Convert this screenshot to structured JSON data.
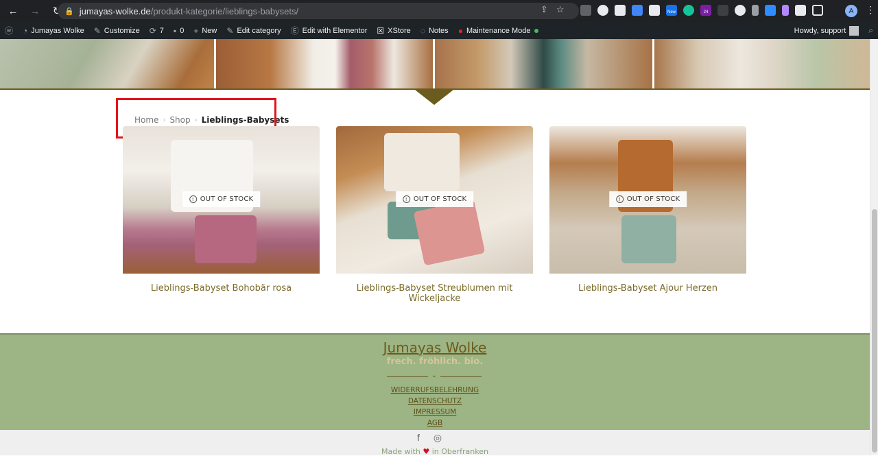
{
  "browser": {
    "url_domain": "jumayas-wolke.de",
    "url_path": "/produkt-kategorie/lieblings-babysets/",
    "profile_initial": "A",
    "ext_badge_new": "New",
    "ext_badge_count": "24"
  },
  "admin_bar": {
    "site_name": "Jumayas Wolke",
    "customize": "Customize",
    "updates_count": "7",
    "comments_count": "0",
    "new": "New",
    "edit_category": "Edit category",
    "edit_elementor": "Edit with Elementor",
    "xstore": "XStore",
    "notes": "Notes",
    "maintenance": "Maintenance Mode",
    "howdy": "Howdy, support"
  },
  "breadcrumb": {
    "home": "Home",
    "shop": "Shop",
    "current": "Lieblings-Babysets"
  },
  "products": [
    {
      "title": "Lieblings-Babyset Bohobär rosa",
      "badge": "OUT OF STOCK"
    },
    {
      "title": "Lieblings-Babyset Streublumen mit Wickeljacke",
      "badge": "OUT OF STOCK"
    },
    {
      "title": "Lieblings-Babyset Ajour Herzen",
      "badge": "OUT OF STOCK"
    }
  ],
  "footer": {
    "brand": "Jumayas Wolke",
    "tagline": "frech. fröhlich. bio.",
    "links": [
      "WIDERRUFSBELEHRUNG",
      "DATENSCHUTZ",
      "IMPRESSUM",
      "AGB"
    ],
    "made_prefix": "Made with",
    "made_heart": "♥",
    "made_suffix": "in Oberfranken"
  },
  "colors": {
    "accent": "#6b5b1e",
    "footer_bg": "#9db484",
    "highlight": "#e3131b"
  }
}
